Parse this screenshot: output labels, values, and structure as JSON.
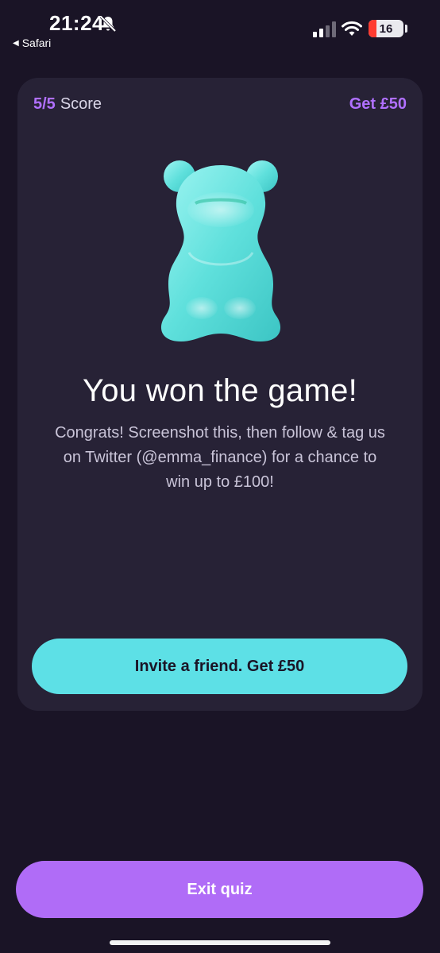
{
  "status_bar": {
    "time": "21:24",
    "back_app": "Safari",
    "battery": "16",
    "icons": [
      "bell-slash-icon",
      "signal-icon",
      "wifi-icon",
      "battery-icon"
    ]
  },
  "card": {
    "score_value": "5/5",
    "score_label": "Score",
    "reward": "Get £50",
    "image": "gummy-bear-icon",
    "title": "You won the game!",
    "body": "Congrats! Screenshot this, then follow & tag us on Twitter (@emma_finance) for a chance to win up to £100!",
    "invite_button": "Invite a friend. Get £50"
  },
  "exit_button": "Exit quiz",
  "colors": {
    "background": "#1a1426",
    "card": "#272236",
    "accent_purple": "#b070ff",
    "invite_button": "#5de0e6",
    "exit_button": "#b06cf7"
  }
}
